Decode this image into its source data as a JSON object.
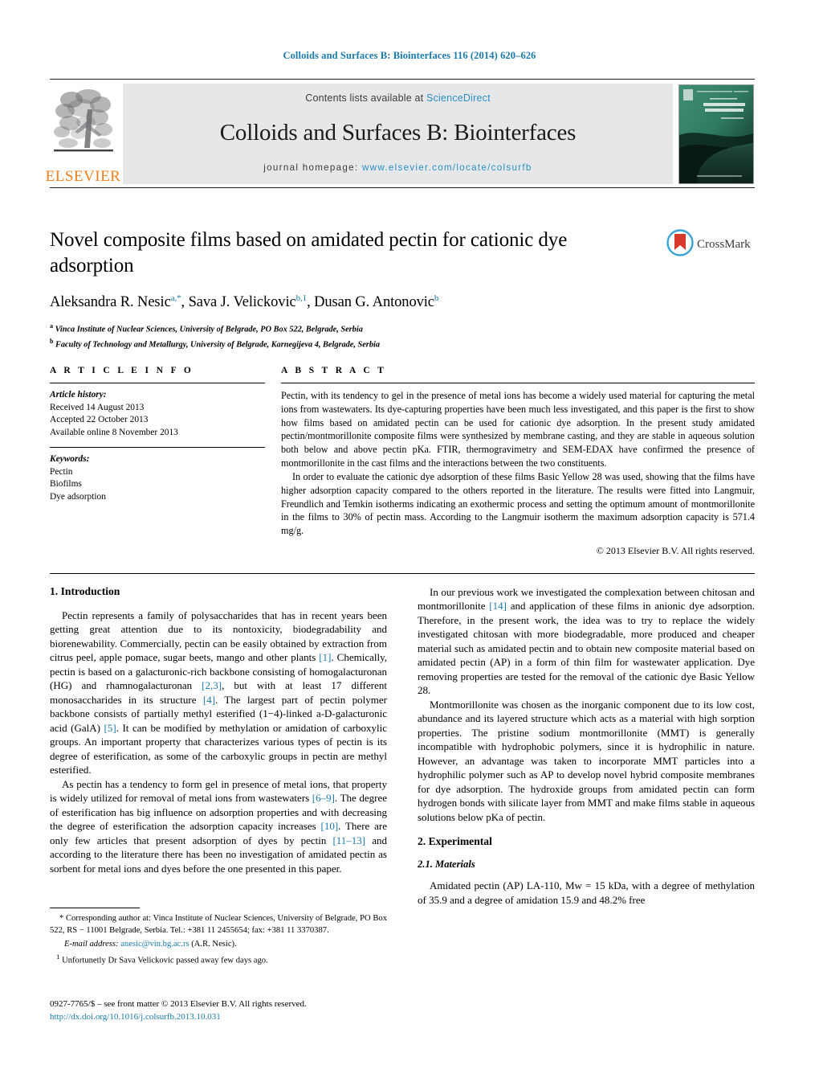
{
  "running_head": "Colloids and Surfaces B: Biointerfaces 116 (2014) 620–626",
  "masthead": {
    "contents_prefix": "Contents lists available at ",
    "sciencedirect": "ScienceDirect",
    "journal_title": "Colloids and Surfaces B: Biointerfaces",
    "homepage_prefix": "journal homepage: ",
    "homepage_url": "www.elsevier.com/locate/colsurfb",
    "publisher": "ELSEVIER",
    "cover_alt": "journal-cover-thumbnail",
    "accent_blue": "#2b8fc4",
    "elsevier_orange": "#f07f1a",
    "band_gray": "#e6e7e8"
  },
  "crossmark": {
    "label": "CrossMark"
  },
  "title": "Novel composite films based on amidated pectin for cationic dye adsorption",
  "authors": [
    {
      "name": "Aleksandra R. Nesic",
      "sup": "a,*"
    },
    {
      "name": "Sava J. Velickovic",
      "sup": "b,1"
    },
    {
      "name": "Dusan G. Antonovic",
      "sup": "b"
    }
  ],
  "affiliations": [
    {
      "marker": "a",
      "text": "Vinca Institute of Nuclear Sciences, University of Belgrade, PO Box 522, Belgrade, Serbia"
    },
    {
      "marker": "b",
      "text": "Faculty of Technology and Metallurgy, University of Belgrade, Karnegijeva 4, Belgrade, Serbia"
    }
  ],
  "article_info": {
    "heading": "A R T I C L E  I N F O",
    "history_label": "Article history:",
    "history": [
      "Received 14 August 2013",
      "Accepted 22 October 2013",
      "Available online 8 November 2013"
    ],
    "keywords_label": "Keywords:",
    "keywords": [
      "Pectin",
      "Biofilms",
      "Dye adsorption"
    ]
  },
  "abstract": {
    "heading": "A B S T R A C T",
    "paragraph1": "Pectin, with its tendency to gel in the presence of metal ions has become a widely used material for capturing the metal ions from wastewaters. Its dye-capturing properties have been much less investigated, and this paper is the first to show how films based on amidated pectin can be used for cationic dye adsorption. In the present study amidated pectin/montmorillonite composite films were synthesized by membrane casting, and they are stable in aqueous solution both below and above pectin pKa. FTIR, thermogravimetry and SEM-EDAX have confirmed the presence of montmorillonite in the cast films and the interactions between the two constituents.",
    "paragraph2": "In order to evaluate the cationic dye adsorption of these films Basic Yellow 28 was used, showing that the films have higher adsorption capacity compared to the others reported in the literature. The results were fitted into Langmuir, Freundlich and Temkin isotherms indicating an exothermic process and setting the optimum amount of montmorillonite in the films to 30% of pectin mass. According to the Langmuir isotherm the maximum adsorption capacity is 571.4 mg/g.",
    "copyright": "© 2013 Elsevier B.V. All rights reserved."
  },
  "sections": {
    "introduction_heading": "1.  Introduction",
    "intro_p1_a": "Pectin represents a family of polysaccharides that has in recent years been getting great attention due to its nontoxicity, biodegradability and biorenewability. Commercially, pectin can be easily obtained by extraction from citrus peel, apple pomace, sugar beets, mango and other plants ",
    "intro_p1_ref1": "[1]",
    "intro_p1_b": ". Chemically, pectin is based on a galacturonic-rich backbone consisting of homogalacturonan (HG) and rhamnogalacturonan ",
    "intro_p1_ref2": "[2,3]",
    "intro_p1_c": ", but with at least 17 different monosaccharides in its structure ",
    "intro_p1_ref3": "[4]",
    "intro_p1_d": ". The largest part of pectin polymer backbone consists of partially methyl esterified (1−4)-linked a-D-galacturonic acid (GalA) ",
    "intro_p1_ref4": "[5]",
    "intro_p1_e": ". It can be modified by methylation or amidation of carboxylic groups. An important property that characterizes various types of pectin is its degree of esterification, as some of the carboxylic groups in pectin are methyl esterified.",
    "intro_p2_a": "As pectin has a tendency to form gel in presence of metal ions, that property is widely utilized for removal of metal ions from wastewaters ",
    "intro_p2_ref1": "[6–9]",
    "intro_p2_b": ". The degree of esterification has big influence on adsorption properties and with decreasing the degree of esterification the adsorption capacity increases ",
    "intro_p2_ref2": "[10]",
    "intro_p2_c": ". There are only few articles that present adsorption of dyes by pectin ",
    "intro_p2_ref3": "[11–13]",
    "intro_p2_d": " and according to the literature there has been no investigation of amidated pectin as sorbent for metal ions and dyes before the one presented in this paper.",
    "right_p1_a": "In our previous work we investigated the complexation between chitosan and montmorillonite ",
    "right_p1_ref1": "[14]",
    "right_p1_b": " and application of these films in anionic dye adsorption. Therefore, in the present work, the idea was to try to replace the widely investigated chitosan with more biodegradable, more produced and cheaper material such as amidated pectin and to obtain new composite material based on amidated pectin (AP) in a form of thin film for wastewater application. Dye removing properties are tested for the removal of the cationic dye Basic Yellow 28.",
    "right_p2": "Montmorillonite was chosen as the inorganic component due to its low cost, abundance and its layered structure which acts as a material with high sorption properties. The pristine sodium montmorillonite (MMT) is generally incompatible with hydrophobic polymers, since it is hydrophilic in nature. However, an advantage was taken to incorporate MMT particles into a hydrophilic polymer such as AP to develop novel hybrid composite membranes for dye adsorption. The hydroxide groups from amidated pectin can form hydrogen bonds with silicate layer from MMT and make films stable in aqueous solutions below pKa of pectin.",
    "experimental_heading": "2.  Experimental",
    "materials_heading": "2.1.  Materials",
    "materials_p1": "Amidated pectin (AP) LA-110, Mw = 15 kDa, with a degree of methylation of 35.9 and a degree of amidation 15.9 and 48.2% free"
  },
  "footnotes": {
    "corresponding": "* Corresponding author at: Vinca Institute of Nuclear Sciences, University of Belgrade, PO Box 522, RS − 11001 Belgrade, Serbia. Tel.: +381 11 2455654; fax: +381 11 3370387.",
    "email_label": "E-mail address:",
    "email": "anesic@vin.bg.ac.rs",
    "email_suffix": " (A.R. Nesic).",
    "note1_marker": "1",
    "note1": "Unfortunetly Dr Sava Velickovic passed away few days ago."
  },
  "issn_line": "0927-7765/$ – see front matter © 2013 Elsevier B.V. All rights reserved.",
  "doi_line": "http://dx.doi.org/10.1016/j.colsurfb.2013.10.031"
}
